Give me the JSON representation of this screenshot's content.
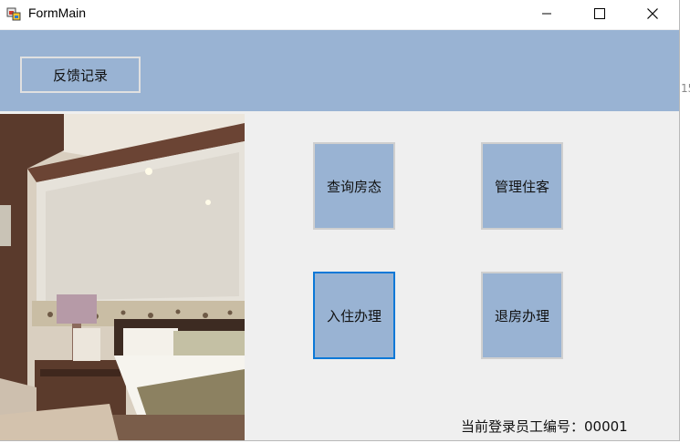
{
  "window": {
    "title": "FormMain",
    "caption_icons": [
      "minimize-icon",
      "maximize-icon",
      "close-icon"
    ]
  },
  "header": {
    "feedback_label": "反馈记录",
    "band_color": "#99b3d3"
  },
  "tiles": {
    "query_room": "查询房态",
    "manage_guests": "管理住客",
    "check_in": "入住办理",
    "check_out": "退房办理"
  },
  "status": {
    "employee_id_label": "当前登录员工编号：00001"
  },
  "edge_fragment": "15",
  "colors": {
    "accent": "#99b3d3",
    "focus": "#0a78d7",
    "background": "#efefef"
  }
}
